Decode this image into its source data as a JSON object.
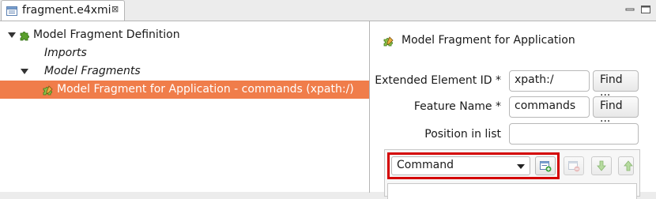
{
  "tab": {
    "title": "fragment.e4xmi",
    "close_glyph": "⊠"
  },
  "tree": {
    "items": [
      {
        "label": "Model Fragment Definition",
        "icon": "puzzle-green-icon"
      },
      {
        "label": "Imports"
      },
      {
        "label": "Model Fragments"
      },
      {
        "label": "Model Fragment for Application - commands (xpath:/)",
        "icon": "puzzle-pencil-icon",
        "selected": true
      }
    ]
  },
  "details": {
    "title": "Model Fragment for Application",
    "extended_element": {
      "label": "Extended Element ID *",
      "value": "xpath:/",
      "find_label": "Find ..."
    },
    "feature_name": {
      "label": "Feature Name *",
      "value": "commands",
      "find_label": "Find ..."
    },
    "position": {
      "label": "Position in list",
      "value": ""
    },
    "type_select": {
      "value": "Command"
    }
  },
  "colors": {
    "selection": "#f07d4a",
    "highlight_border": "#d40000"
  }
}
